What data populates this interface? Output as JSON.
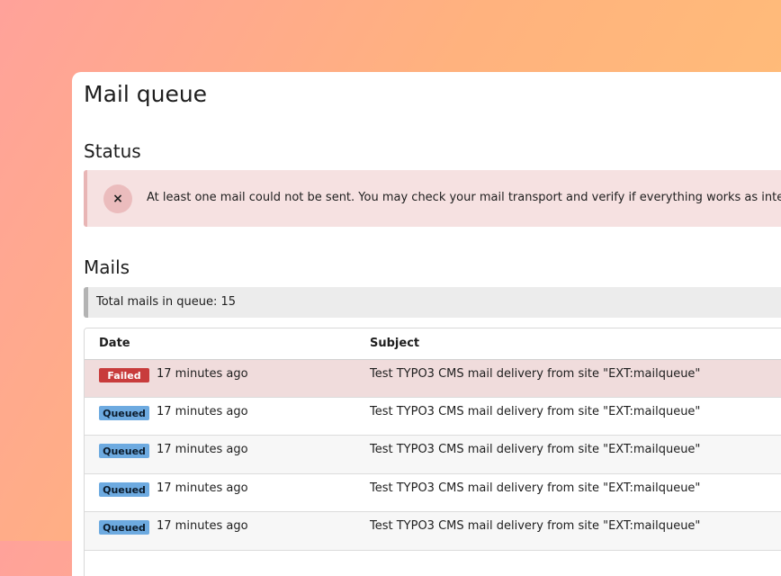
{
  "page": {
    "title": "Mail queue"
  },
  "status": {
    "title": "Status",
    "alert": {
      "icon": "close-icon",
      "icon_glyph": "×",
      "message": "At least one mail could not be sent. You may check your mail transport and verify if everything works as intended."
    }
  },
  "mails": {
    "title": "Mails",
    "total_label": "Total mails in queue: 15",
    "columns": {
      "date": "Date",
      "subject": "Subject"
    },
    "rows": [
      {
        "status": "Failed",
        "time": "17 minutes ago",
        "subject": "Test TYPO3 CMS mail delivery from site \"EXT:mailqueue\""
      },
      {
        "status": "Queued",
        "time": "17 minutes ago",
        "subject": "Test TYPO3 CMS mail delivery from site \"EXT:mailqueue\""
      },
      {
        "status": "Queued",
        "time": "17 minutes ago",
        "subject": "Test TYPO3 CMS mail delivery from site \"EXT:mailqueue\""
      },
      {
        "status": "Queued",
        "time": "17 minutes ago",
        "subject": "Test TYPO3 CMS mail delivery from site \"EXT:mailqueue\""
      },
      {
        "status": "Queued",
        "time": "17 minutes ago",
        "subject": "Test TYPO3 CMS mail delivery from site \"EXT:mailqueue\""
      }
    ]
  },
  "colors": {
    "failed_badge": "#c83c3c",
    "queued_badge": "#6daae0",
    "alert_bg": "#f6e1e1"
  }
}
